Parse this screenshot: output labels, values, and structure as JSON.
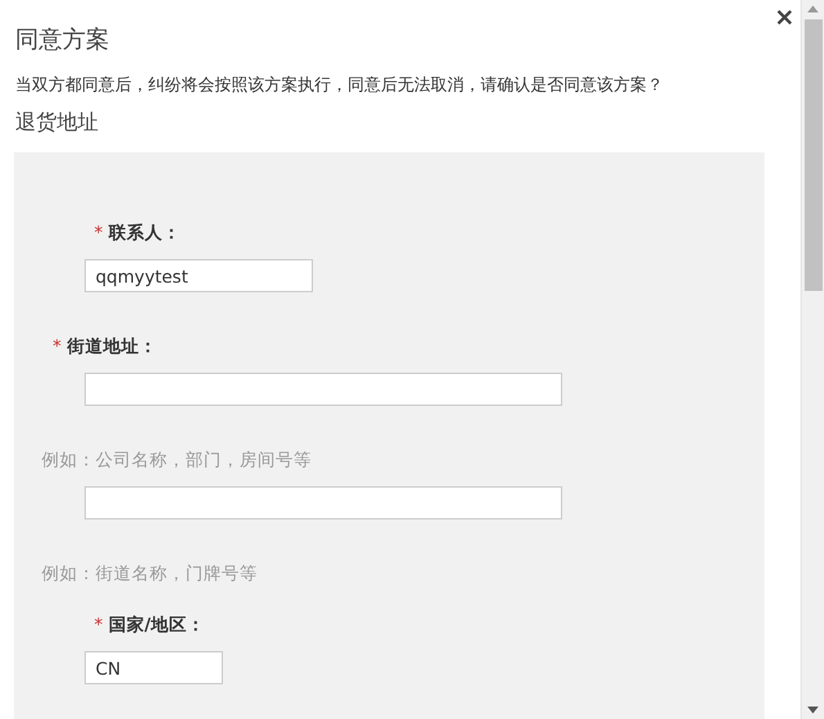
{
  "dialog": {
    "title": "同意方案",
    "message": "当双方都同意后，纠纷将会按照该方案执行，同意后无法取消，请确认是否同意该方案？",
    "section_title": "退货地址",
    "fields": [
      {
        "kind": "label",
        "text": "联系人：",
        "required_mark": "*",
        "indented": true
      },
      {
        "kind": "input",
        "value": "qqmyytest"
      },
      {
        "kind": "label",
        "text": "街道地址：",
        "required_mark": "*",
        "indented": false
      },
      {
        "kind": "input"
      },
      {
        "kind": "hint",
        "text": "例如：公司名称，部门，房间号等"
      },
      {
        "kind": "input"
      },
      {
        "kind": "hint",
        "text": "例如：街道名称，门牌号等"
      },
      {
        "kind": "label",
        "text": "国家/地区：",
        "required_mark": "*",
        "indented": true
      },
      {
        "kind": "input",
        "value": "CN"
      }
    ]
  }
}
